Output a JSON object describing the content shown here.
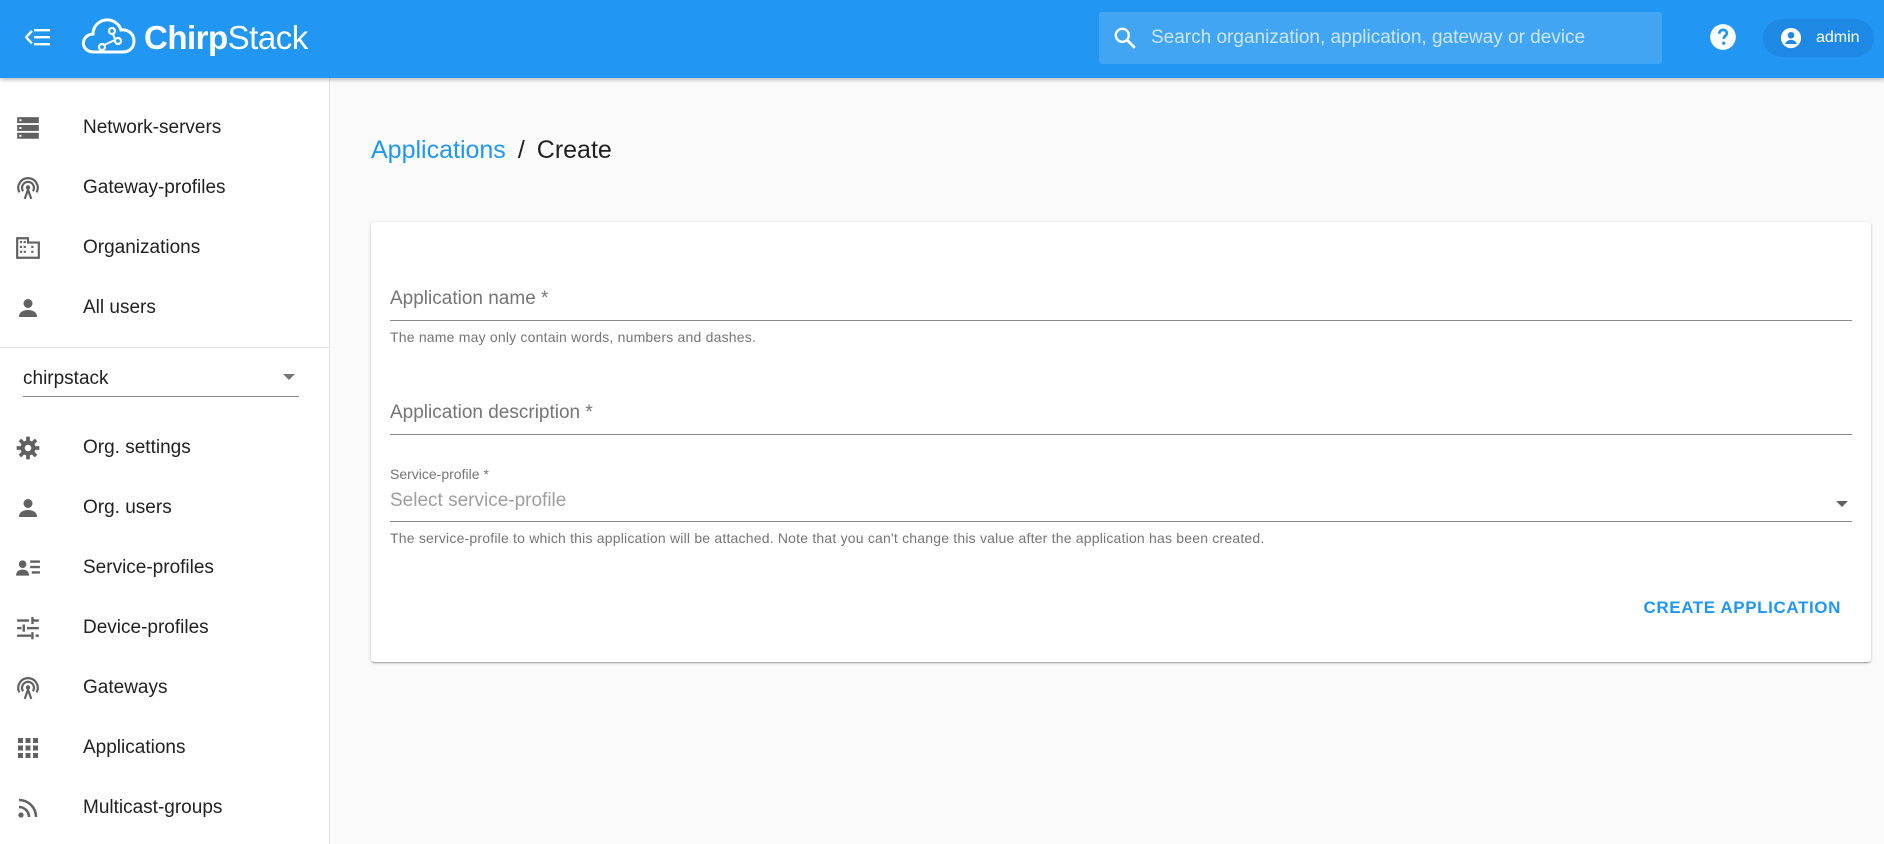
{
  "header": {
    "brand_part1": "Chirp",
    "brand_part2": "Stack",
    "search_placeholder": "Search organization, application, gateway or device",
    "user_name": "admin"
  },
  "sidebar": {
    "admin_items": [
      {
        "label": "Network-servers",
        "icon": "server-icon"
      },
      {
        "label": "Gateway-profiles",
        "icon": "gateway-icon"
      },
      {
        "label": "Organizations",
        "icon": "building-icon"
      },
      {
        "label": "All users",
        "icon": "person-icon"
      }
    ],
    "org_selected": "chirpstack",
    "org_items": [
      {
        "label": "Org. settings",
        "icon": "gear-icon"
      },
      {
        "label": "Org. users",
        "icon": "person-icon"
      },
      {
        "label": "Service-profiles",
        "icon": "account-details-icon"
      },
      {
        "label": "Device-profiles",
        "icon": "tune-icon"
      },
      {
        "label": "Gateways",
        "icon": "gateway-icon"
      },
      {
        "label": "Applications",
        "icon": "apps-grid-icon"
      },
      {
        "label": "Multicast-groups",
        "icon": "rss-icon"
      }
    ]
  },
  "breadcrumb": {
    "link": "Applications",
    "separator": "/",
    "current": "Create"
  },
  "form": {
    "name_label": "Application name *",
    "name_helper": "The name may only contain words, numbers and dashes.",
    "description_label": "Application description *",
    "service_profile_label": "Service-profile *",
    "service_profile_placeholder": "Select service-profile",
    "service_profile_helper": "The service-profile to which this application will be attached. Note that you can't change this value after the application has been created.",
    "submit_label": "CREATE APPLICATION"
  },
  "colors": {
    "primary": "#2196f3",
    "appbar": "#2196f3",
    "user_chip": "#1e88e5",
    "background": "#fafafa"
  }
}
